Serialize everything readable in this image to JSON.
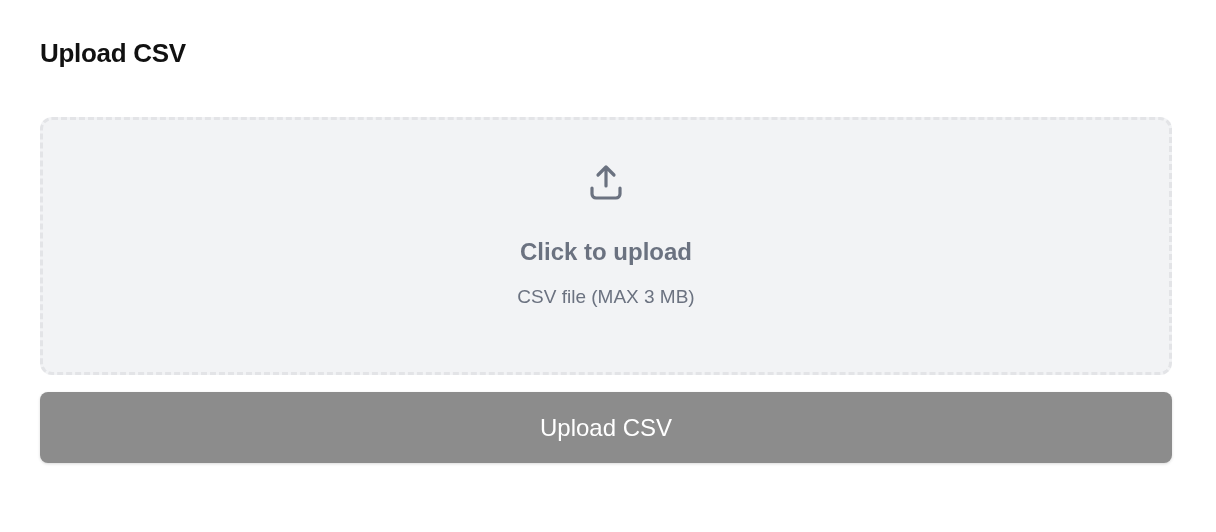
{
  "title": "Upload CSV",
  "dropzone": {
    "label": "Click to upload",
    "hint": "CSV file (MAX 3 MB)"
  },
  "button": {
    "label": "Upload CSV",
    "disabled": true
  }
}
